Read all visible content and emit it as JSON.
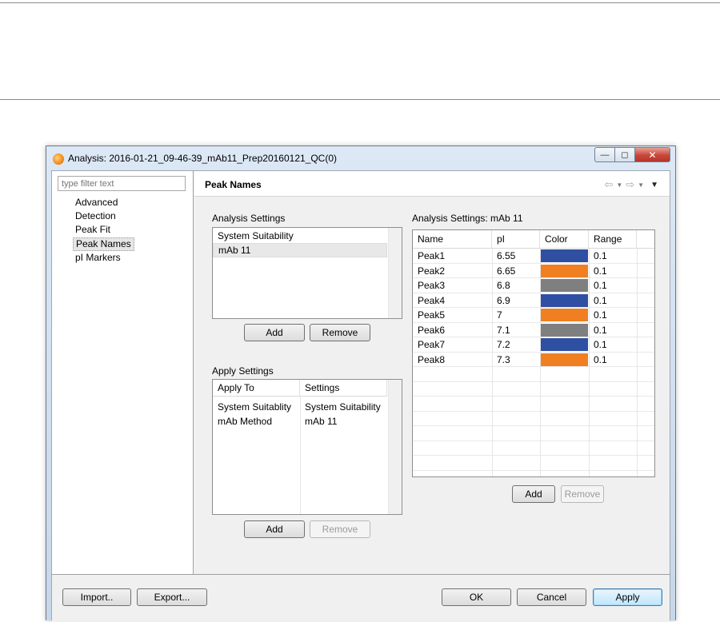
{
  "window": {
    "title": "Analysis: 2016-01-21_09-46-39_mAb11_Prep20160121_QC(0)"
  },
  "nav": {
    "filter_placeholder": "type filter text",
    "items": [
      {
        "label": "Advanced"
      },
      {
        "label": "Detection"
      },
      {
        "label": "Peak Fit"
      },
      {
        "label": "Peak Names",
        "selected": true
      },
      {
        "label": "pI Markers"
      }
    ]
  },
  "page": {
    "title": "Peak Names"
  },
  "analysis_settings": {
    "label": "Analysis Settings",
    "items": [
      "System Suitability",
      "mAb 11"
    ],
    "selected_index": 1,
    "add_label": "Add",
    "remove_label": "Remove"
  },
  "apply_settings": {
    "label": "Apply Settings",
    "columns": [
      "Apply To",
      "Settings"
    ],
    "rows": [
      {
        "apply_to": "System Suitablity",
        "settings": "System Suitability"
      },
      {
        "apply_to": "mAb Method",
        "settings": "mAb 11"
      }
    ],
    "add_label": "Add",
    "remove_label": "Remove"
  },
  "peak_settings": {
    "label": "Analysis Settings: mAb 11",
    "columns": [
      "Name",
      "pI",
      "Color",
      "Range"
    ],
    "rows": [
      {
        "name": "Peak1",
        "pi": "6.55",
        "color": "#2f4fa2",
        "range": "0.1"
      },
      {
        "name": "Peak2",
        "pi": "6.65",
        "color": "#f07f22",
        "range": "0.1"
      },
      {
        "name": "Peak3",
        "pi": "6.8",
        "color": "#7f7f7f",
        "range": "0.1"
      },
      {
        "name": "Peak4",
        "pi": "6.9",
        "color": "#2f4fa2",
        "range": "0.1"
      },
      {
        "name": "Peak5",
        "pi": "7",
        "color": "#f07f22",
        "range": "0.1"
      },
      {
        "name": "Peak6",
        "pi": "7.1",
        "color": "#7f7f7f",
        "range": "0.1"
      },
      {
        "name": "Peak7",
        "pi": "7.2",
        "color": "#2f4fa2",
        "range": "0.1"
      },
      {
        "name": "Peak8",
        "pi": "7.3",
        "color": "#f07f22",
        "range": "0.1"
      }
    ],
    "add_label": "Add",
    "remove_label": "Remove"
  },
  "footer": {
    "import_label": "Import..",
    "export_label": "Export...",
    "ok_label": "OK",
    "cancel_label": "Cancel",
    "apply_label": "Apply"
  }
}
